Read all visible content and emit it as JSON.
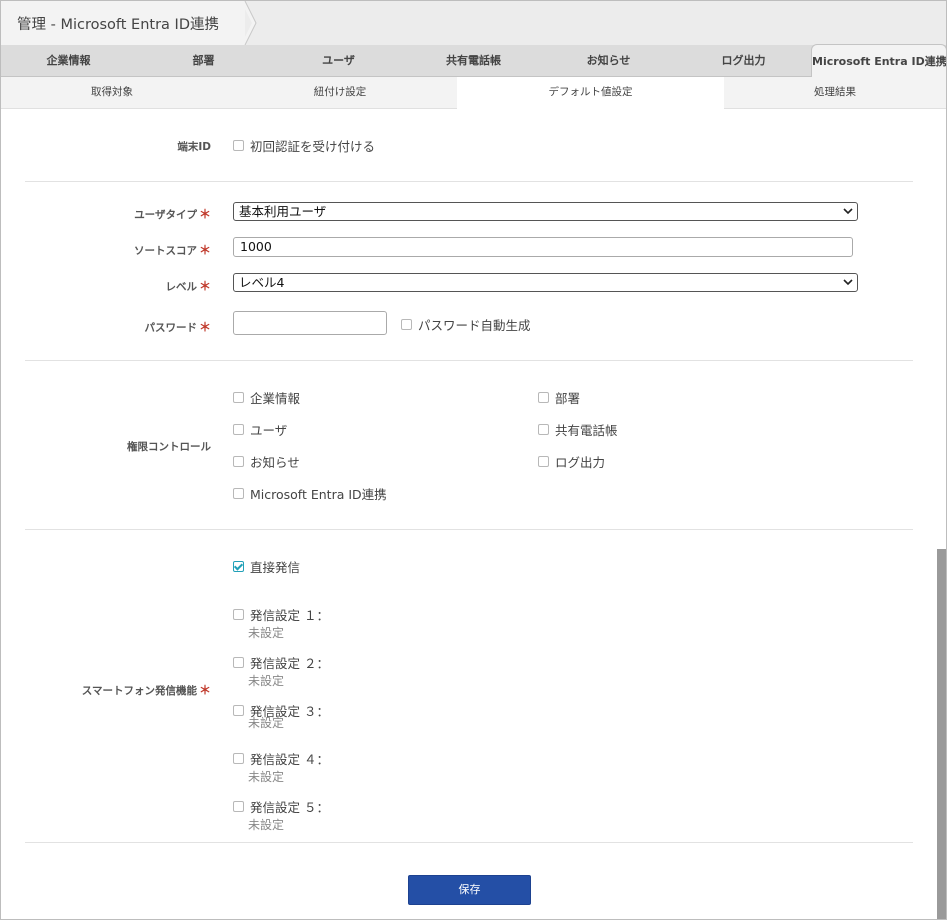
{
  "breadcrumb": {
    "title": "管理 - Microsoft Entra ID連携"
  },
  "main_tabs": [
    {
      "label": "企業情報"
    },
    {
      "label": "部署"
    },
    {
      "label": "ユーザ"
    },
    {
      "label": "共有電話帳"
    },
    {
      "label": "お知らせ"
    },
    {
      "label": "ログ出力"
    },
    {
      "label": "Microsoft Entra ID連携"
    }
  ],
  "sub_tabs": [
    {
      "label": "取得対象"
    },
    {
      "label": "紐付け設定"
    },
    {
      "label": "デフォルト値設定"
    },
    {
      "label": "処理結果"
    }
  ],
  "form": {
    "terminal_id": {
      "label": "端末ID",
      "checkbox": "初回認証を受け付ける",
      "checked": false
    },
    "user_type": {
      "label": "ユーザタイプ",
      "value": "基本利用ユーザ"
    },
    "sort_score": {
      "label": "ソートスコア",
      "value": "1000"
    },
    "level": {
      "label": "レベル",
      "value": "レベル4"
    },
    "password": {
      "label": "パスワード",
      "value": "",
      "auto_generate": "パスワード自動生成",
      "auto_checked": false
    },
    "permission": {
      "label": "権限コントロール",
      "items": [
        {
          "label": "企業情報",
          "checked": false
        },
        {
          "label": "部署",
          "checked": false
        },
        {
          "label": "ユーザ",
          "checked": false
        },
        {
          "label": "共有電話帳",
          "checked": false
        },
        {
          "label": "お知らせ",
          "checked": false
        },
        {
          "label": "ログ出力",
          "checked": false
        },
        {
          "label": "Microsoft Entra ID連携",
          "checked": false
        }
      ]
    },
    "smartphone": {
      "label": "スマートフォン発信機能",
      "direct": {
        "label": "直接発信",
        "checked": true
      },
      "settings": [
        {
          "label": "発信設定 １：",
          "status": "未設定",
          "checked": false
        },
        {
          "label": "発信設定 ２：",
          "status": "未設定",
          "checked": false
        },
        {
          "label": "発信設定 ３：",
          "status": "未設定",
          "checked": false
        },
        {
          "label": "発信設定 ４：",
          "status": "未設定",
          "checked": false
        },
        {
          "label": "発信設定 ５：",
          "status": "未設定",
          "checked": false
        }
      ]
    },
    "required_mark": "＊",
    "save_label": "保存"
  },
  "colors": {
    "accent_button": "#244fa6",
    "required": "#c0392b",
    "check": "#21a0b8"
  }
}
